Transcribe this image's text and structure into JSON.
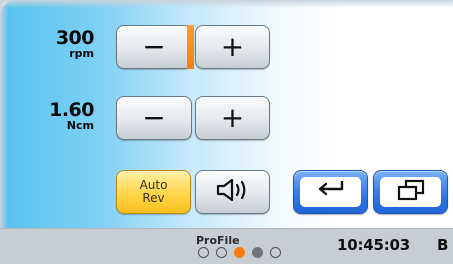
{
  "speed": {
    "value": "300",
    "unit": "rpm",
    "decrease_symbol": "−",
    "increase_symbol": "+"
  },
  "torque": {
    "value": "1.60",
    "unit": "Ncm",
    "decrease_symbol": "−",
    "increase_symbol": "+"
  },
  "auto_rev": {
    "line1": "Auto",
    "line2": "Rev"
  },
  "icons": {
    "sound": "speaker-icon",
    "reverse": "return-arrow-icon",
    "program": "overlapping-windows-icon"
  },
  "status": {
    "program_name": "ProFile",
    "program_slots": [
      {
        "state": "empty"
      },
      {
        "state": "empty"
      },
      {
        "state": "active"
      },
      {
        "state": "filled"
      },
      {
        "state": "empty"
      }
    ],
    "time": "10:45:03",
    "battery_letter": "B"
  },
  "colors": {
    "accent_orange": "#f57d0b",
    "slot_filled": "#6f7479",
    "blue_button": "#2a72e0",
    "auto_rev_yellow": "#ffd64a"
  }
}
